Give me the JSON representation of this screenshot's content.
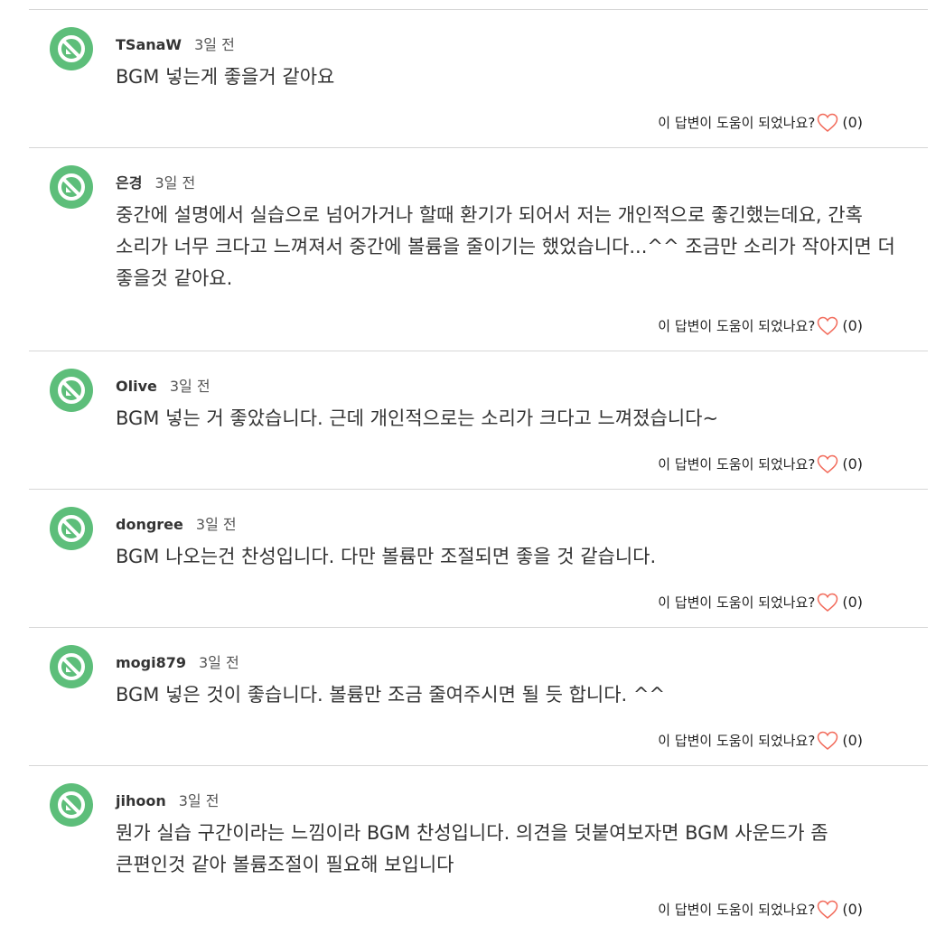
{
  "helpful_label": "이 답변이 도움이 되었나요?",
  "comments": [
    {
      "author": "TSanaW",
      "time": "3일 전",
      "text": "BGM 넣는게 좋을거 같아요",
      "helpful_count": "(0)"
    },
    {
      "author": "은경",
      "time": "3일 전",
      "text": "중간에 설명에서 실습으로 넘어가거나 할때 환기가 되어서 저는 개인적으로 좋긴했는데요, 간혹 소리가 너무 크다고 느껴져서 중간에 볼륨을 줄이기는 했었습니다...^^ 조금만 소리가 작아지면 더 좋을것 같아요.",
      "helpful_count": "(0)"
    },
    {
      "author": "Olive",
      "time": "3일 전",
      "text": "BGM 넣는 거 좋았습니다. 근데 개인적으로는 소리가 크다고 느껴졌습니다~",
      "helpful_count": "(0)"
    },
    {
      "author": "dongree",
      "time": "3일 전",
      "text": "BGM 나오는건 찬성입니다. 다만 볼륨만 조절되면 좋을 것 같습니다.",
      "helpful_count": "(0)"
    },
    {
      "author": "mogi879",
      "time": "3일 전",
      "text": "BGM 넣은 것이 좋습니다. 볼륨만 조금 줄여주시면 될 듯 합니다. ^^",
      "helpful_count": "(0)"
    },
    {
      "author": "jihoon",
      "time": "3일 전",
      "text": "뭔가 실습 구간이라는 느낌이라 BGM 찬성입니다. 의견을 덧붙여보자면 BGM 사운드가 좀 큰편인것 같아 볼륨조절이 필요해 보입니다",
      "helpful_count": "(0)"
    }
  ],
  "colors": {
    "avatar_bg": "#5dbe7a",
    "heart": "#f26b5b",
    "divider": "#d6d6d6"
  },
  "icons": {
    "avatar": "no-image-user-icon",
    "like": "heart-outline-icon"
  }
}
